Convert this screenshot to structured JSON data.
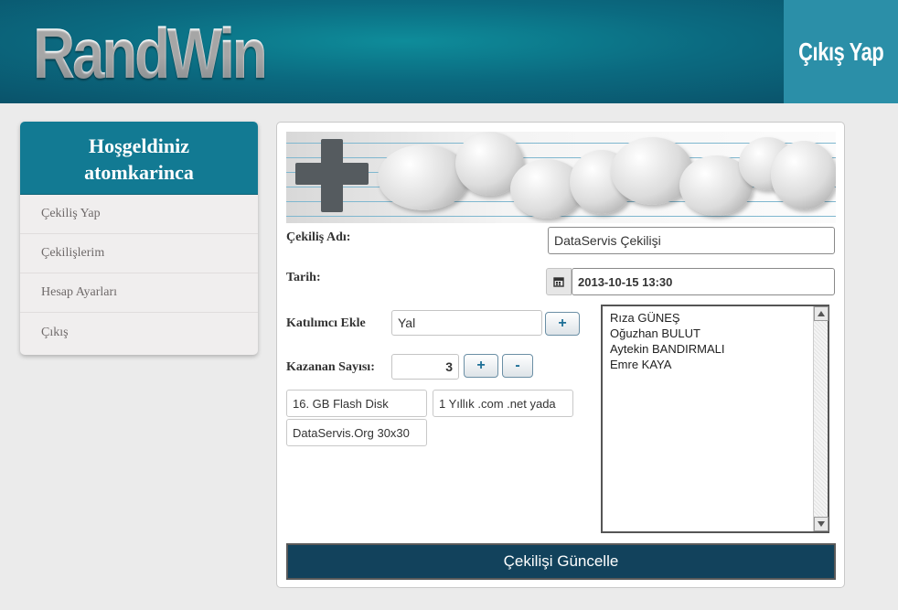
{
  "header": {
    "logo_text": "RandWin",
    "logout_label": "Çıkış Yap"
  },
  "sidebar": {
    "welcome_line1": "Hoşgeldiniz",
    "welcome_line2": "atomkarinca",
    "items": [
      {
        "label": "Çekiliş Yap"
      },
      {
        "label": "Çekilişlerim"
      },
      {
        "label": "Hesap Ayarları"
      },
      {
        "label": "Çıkış"
      }
    ]
  },
  "form": {
    "name_label": "Çekiliş Adı:",
    "name_value": "DataServis Çekilişi",
    "date_label": "Tarih:",
    "date_value": "2013-10-15 13:30",
    "participant_label": "Katılımcı Ekle",
    "participant_value": "Yal",
    "add_button": "+",
    "winner_label": "Kazanan Sayısı:",
    "winner_value": "3",
    "increment_button": "+",
    "decrement_button": "-",
    "prizes": [
      {
        "label": "16. GB Flash Disk"
      },
      {
        "label": "1 Yıllık .com .net yada"
      },
      {
        "label": "DataServis.Org 30x30"
      }
    ],
    "participants": [
      "Rıza GÜNEŞ",
      "Oğuzhan BULUT",
      "Aytekin BANDIRMALI",
      "Emre KAYA"
    ],
    "submit_label": "Çekilişi Güncelle"
  },
  "icons": {
    "calendar": "calendar-icon",
    "scroll_up": "arrow-up-icon",
    "scroll_down": "arrow-down-icon"
  },
  "colors": {
    "header": "#0b6a80",
    "accent": "#127a93",
    "logout_bg": "#2b8fa8",
    "submit_bg": "#12425c"
  }
}
